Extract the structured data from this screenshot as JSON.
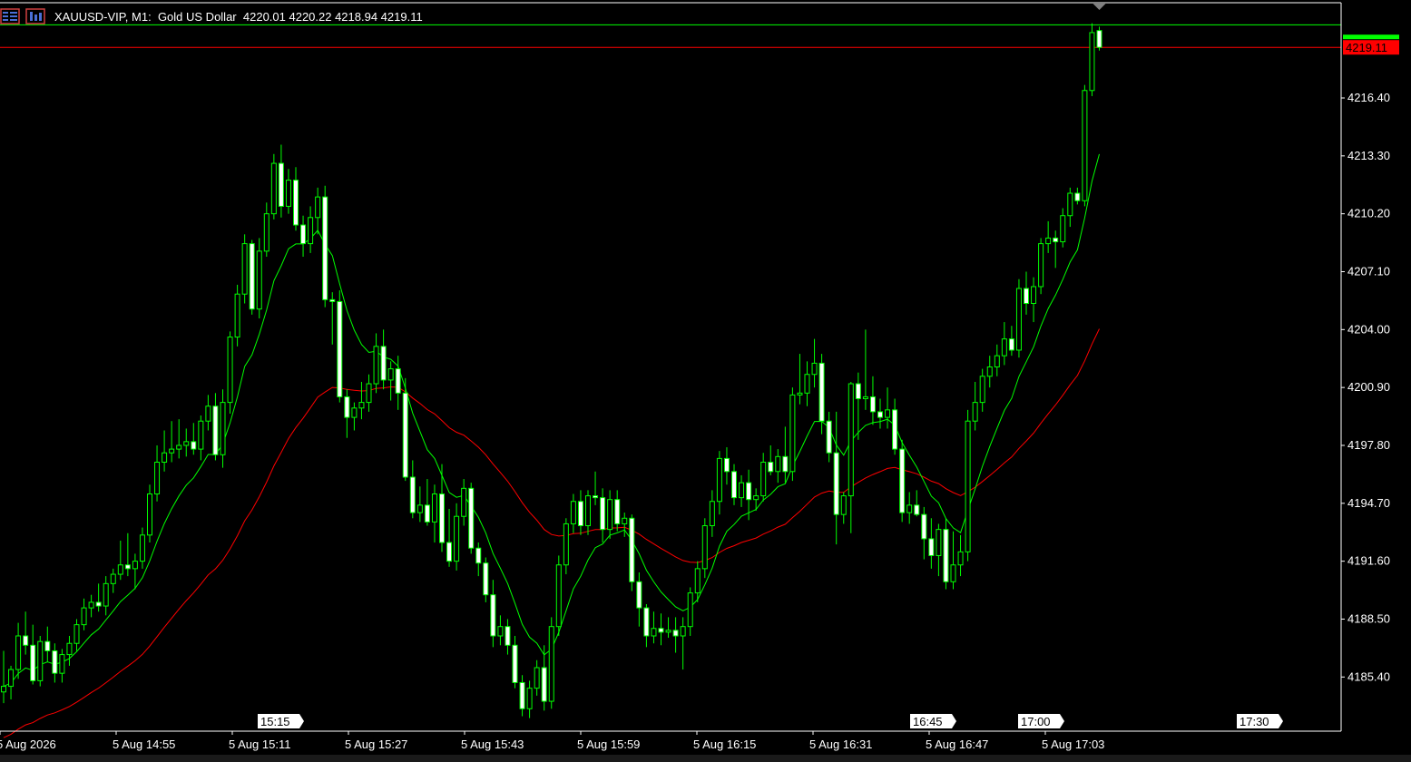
{
  "header": {
    "symbol": "XAUUSD-VIP",
    "timeframe": "M1:",
    "description": "Gold US Dollar",
    "ohlc": "4220.01 4220.22 4218.94 4219.11"
  },
  "chart_data": {
    "type": "candlestick",
    "symbol": "XAUUSD-VIP",
    "timeframe": "M1",
    "current_price": "4219.11",
    "ylim": [
      4182.5,
      4221.5
    ],
    "y_ticks": [
      "4216.40",
      "4213.30",
      "4210.20",
      "4207.10",
      "4204.00",
      "4200.90",
      "4197.80",
      "4194.70",
      "4191.60",
      "4188.50",
      "4185.40"
    ],
    "x_labels": [
      "5 Aug 2026",
      "5 Aug 14:55",
      "5 Aug 15:11",
      "5 Aug 15:27",
      "5 Aug 15:43",
      "5 Aug 15:59",
      "5 Aug 16:15",
      "5 Aug 16:31",
      "5 Aug 16:47",
      "5 Aug 17:03"
    ],
    "time_markers": [
      "15:15",
      "16:45",
      "17:00",
      "17:30"
    ],
    "candles": [
      [
        4184.6,
        4186.8,
        4184.0,
        4184.9
      ],
      [
        4184.9,
        4186.0,
        4184.2,
        4185.8
      ],
      [
        4185.8,
        4188.3,
        4185.3,
        4187.6
      ],
      [
        4187.6,
        4188.9,
        4186.6,
        4187.1
      ],
      [
        4187.1,
        4188.2,
        4185.0,
        4185.2
      ],
      [
        4185.2,
        4187.6,
        4184.9,
        4187.3
      ],
      [
        4187.3,
        4188.1,
        4186.2,
        4186.8
      ],
      [
        4186.8,
        4187.2,
        4185.1,
        4185.6
      ],
      [
        4185.6,
        4186.9,
        4185.1,
        4186.6
      ],
      [
        4186.6,
        4187.6,
        4186.0,
        4187.2
      ],
      [
        4187.2,
        4188.5,
        4186.8,
        4188.2
      ],
      [
        4188.2,
        4189.6,
        4187.9,
        4189.1
      ],
      [
        4189.1,
        4189.8,
        4188.6,
        4189.4
      ],
      [
        4189.4,
        4190.4,
        4188.9,
        4189.2
      ],
      [
        4189.2,
        4190.8,
        4188.7,
        4190.4
      ],
      [
        4190.4,
        4191.2,
        4189.9,
        4190.9
      ],
      [
        4190.9,
        4192.7,
        4190.6,
        4191.4
      ],
      [
        4191.4,
        4193.1,
        4190.8,
        4191.2
      ],
      [
        4191.2,
        4192.0,
        4190.1,
        4191.6
      ],
      [
        4191.6,
        4193.4,
        4191.2,
        4193.0
      ],
      [
        4193.0,
        4195.7,
        4192.6,
        4195.2
      ],
      [
        4195.2,
        4197.8,
        4194.8,
        4196.9
      ],
      [
        4196.9,
        4198.6,
        4196.4,
        4197.4
      ],
      [
        4197.4,
        4199.1,
        4196.9,
        4197.6
      ],
      [
        4197.6,
        4199.2,
        4197.1,
        4197.8
      ],
      [
        4197.8,
        4198.7,
        4197.2,
        4198.0
      ],
      [
        4198.0,
        4199.0,
        4197.3,
        4197.6
      ],
      [
        4197.6,
        4199.4,
        4197.0,
        4199.1
      ],
      [
        4199.1,
        4200.5,
        4198.6,
        4199.9
      ],
      [
        4199.9,
        4200.6,
        4197.0,
        4197.3
      ],
      [
        4197.3,
        4200.8,
        4196.6,
        4200.1
      ],
      [
        4200.1,
        4203.9,
        4199.5,
        4203.6
      ],
      [
        4203.6,
        4206.4,
        4203.1,
        4205.9
      ],
      [
        4205.9,
        4209.1,
        4205.4,
        4208.6
      ],
      [
        4208.6,
        4208.8,
        4204.8,
        4205.1
      ],
      [
        4205.1,
        4208.9,
        4204.6,
        4208.2
      ],
      [
        4208.2,
        4210.8,
        4207.9,
        4210.2
      ],
      [
        4210.2,
        4213.4,
        4209.9,
        4212.9
      ],
      [
        4212.9,
        4213.9,
        4210.0,
        4210.6
      ],
      [
        4210.6,
        4212.6,
        4210.2,
        4212.0
      ],
      [
        4212.0,
        4212.7,
        4209.3,
        4209.6
      ],
      [
        4209.6,
        4210.1,
        4207.9,
        4208.6
      ],
      [
        4208.6,
        4210.6,
        4208.1,
        4210.0
      ],
      [
        4210.0,
        4211.6,
        4209.1,
        4211.1
      ],
      [
        4211.1,
        4211.7,
        4205.2,
        4205.6
      ],
      [
        4205.6,
        4206.0,
        4203.2,
        4205.5
      ],
      [
        4205.5,
        4206.1,
        4200.1,
        4200.4
      ],
      [
        4200.4,
        4200.8,
        4198.2,
        4199.3
      ],
      [
        4199.3,
        4200.1,
        4198.6,
        4199.8
      ],
      [
        4199.8,
        4201.2,
        4199.2,
        4200.1
      ],
      [
        4200.1,
        4201.6,
        4199.6,
        4201.1
      ],
      [
        4201.1,
        4203.8,
        4200.6,
        4203.1
      ],
      [
        4203.1,
        4204.0,
        4200.8,
        4201.3
      ],
      [
        4201.3,
        4202.3,
        4200.2,
        4201.9
      ],
      [
        4201.9,
        4202.6,
        4199.7,
        4200.6
      ],
      [
        4200.6,
        4201.4,
        4195.9,
        4196.1
      ],
      [
        4196.1,
        4197.0,
        4193.9,
        4194.2
      ],
      [
        4194.2,
        4195.6,
        4193.7,
        4194.6
      ],
      [
        4194.6,
        4196.0,
        4193.5,
        4193.7
      ],
      [
        4193.7,
        4195.7,
        4192.6,
        4195.2
      ],
      [
        4195.2,
        4196.8,
        4192.1,
        4192.6
      ],
      [
        4192.6,
        4194.4,
        4191.3,
        4191.6
      ],
      [
        4191.6,
        4194.7,
        4191.1,
        4194.0
      ],
      [
        4194.0,
        4196.0,
        4193.5,
        4195.5
      ],
      [
        4195.5,
        4195.8,
        4192.0,
        4192.3
      ],
      [
        4192.3,
        4192.6,
        4190.8,
        4191.5
      ],
      [
        4191.5,
        4191.8,
        4189.4,
        4189.8
      ],
      [
        4189.8,
        4190.6,
        4187.0,
        4187.6
      ],
      [
        4187.6,
        4188.7,
        4187.1,
        4188.1
      ],
      [
        4188.1,
        4188.5,
        4186.6,
        4187.1
      ],
      [
        4187.1,
        4187.6,
        4184.8,
        4185.1
      ],
      [
        4185.1,
        4185.5,
        4183.3,
        4183.7
      ],
      [
        4183.7,
        4185.2,
        4183.2,
        4184.8
      ],
      [
        4184.8,
        4186.3,
        4184.4,
        4185.9
      ],
      [
        4185.9,
        4187.1,
        4183.6,
        4184.1
      ],
      [
        4184.1,
        4188.6,
        4183.7,
        4188.1
      ],
      [
        4188.1,
        4191.9,
        4187.6,
        4191.4
      ],
      [
        4191.4,
        4193.9,
        4190.9,
        4193.6
      ],
      [
        4193.6,
        4195.2,
        4193.1,
        4194.8
      ],
      [
        4194.8,
        4195.4,
        4193.0,
        4193.5
      ],
      [
        4193.5,
        4195.4,
        4193.0,
        4195.1
      ],
      [
        4195.1,
        4196.4,
        4194.6,
        4195.0
      ],
      [
        4195.0,
        4195.5,
        4192.6,
        4193.3
      ],
      [
        4193.3,
        4195.4,
        4192.8,
        4194.9
      ],
      [
        4194.9,
        4195.4,
        4193.2,
        4193.6
      ],
      [
        4193.6,
        4194.2,
        4192.9,
        4193.9
      ],
      [
        4193.9,
        4194.1,
        4190.0,
        4190.5
      ],
      [
        4190.5,
        4191.0,
        4188.1,
        4189.1
      ],
      [
        4189.1,
        4189.3,
        4187.0,
        4187.6
      ],
      [
        4187.6,
        4188.9,
        4187.2,
        4188.0
      ],
      [
        4188.0,
        4188.8,
        4187.1,
        4187.8
      ],
      [
        4187.8,
        4188.6,
        4187.5,
        4187.9
      ],
      [
        4187.9,
        4188.6,
        4186.7,
        4187.6
      ],
      [
        4187.6,
        4188.6,
        4185.8,
        4188.1
      ],
      [
        4188.1,
        4190.2,
        4187.6,
        4189.9
      ],
      [
        4189.9,
        4191.6,
        4189.4,
        4191.2
      ],
      [
        4191.2,
        4193.9,
        4190.7,
        4193.5
      ],
      [
        4193.5,
        4195.4,
        4192.9,
        4194.8
      ],
      [
        4194.8,
        4197.5,
        4194.1,
        4197.1
      ],
      [
        4197.1,
        4197.7,
        4195.7,
        4196.4
      ],
      [
        4196.4,
        4196.8,
        4194.6,
        4195.0
      ],
      [
        4195.0,
        4196.2,
        4194.5,
        4195.8
      ],
      [
        4195.8,
        4196.5,
        4193.8,
        4194.9
      ],
      [
        4194.9,
        4195.5,
        4194.3,
        4195.1
      ],
      [
        4195.1,
        4197.4,
        4194.8,
        4196.9
      ],
      [
        4196.9,
        4197.8,
        4196.2,
        4196.4
      ],
      [
        4196.4,
        4197.6,
        4195.8,
        4197.2
      ],
      [
        4197.2,
        4198.8,
        4195.8,
        4196.4
      ],
      [
        4196.4,
        4200.9,
        4195.9,
        4200.5
      ],
      [
        4200.5,
        4202.7,
        4200.0,
        4200.6
      ],
      [
        4200.6,
        4202.3,
        4199.9,
        4201.6
      ],
      [
        4201.6,
        4203.5,
        4200.9,
        4202.2
      ],
      [
        4202.2,
        4202.7,
        4198.4,
        4199.1
      ],
      [
        4199.1,
        4199.6,
        4196.9,
        4197.4
      ],
      [
        4197.4,
        4199.6,
        4192.5,
        4194.1
      ],
      [
        4194.1,
        4195.3,
        4193.6,
        4195.1
      ],
      [
        4195.1,
        4201.2,
        4193.1,
        4201.1
      ],
      [
        4201.1,
        4201.7,
        4198.1,
        4200.3
      ],
      [
        4200.3,
        4204.0,
        4199.7,
        4200.4
      ],
      [
        4200.4,
        4201.5,
        4198.9,
        4199.6
      ],
      [
        4199.6,
        4200.3,
        4198.7,
        4199.3
      ],
      [
        4199.3,
        4200.9,
        4198.7,
        4199.7
      ],
      [
        4199.7,
        4200.3,
        4197.3,
        4197.6
      ],
      [
        4197.6,
        4198.1,
        4193.7,
        4194.2
      ],
      [
        4194.2,
        4195.3,
        4193.6,
        4194.6
      ],
      [
        4194.6,
        4195.4,
        4194.0,
        4194.1
      ],
      [
        4194.1,
        4194.5,
        4191.7,
        4192.8
      ],
      [
        4192.8,
        4193.9,
        4191.2,
        4191.9
      ],
      [
        4191.9,
        4193.6,
        4190.8,
        4193.3
      ],
      [
        4193.3,
        4193.9,
        4190.1,
        4190.5
      ],
      [
        4190.5,
        4193.2,
        4190.1,
        4191.4
      ],
      [
        4191.4,
        4193.0,
        4190.8,
        4192.1
      ],
      [
        4192.1,
        4199.7,
        4191.6,
        4199.1
      ],
      [
        4199.1,
        4201.2,
        4198.6,
        4200.1
      ],
      [
        4200.1,
        4201.9,
        4199.6,
        4201.5
      ],
      [
        4201.5,
        4202.6,
        4200.9,
        4202.0
      ],
      [
        4202.0,
        4203.2,
        4201.5,
        4202.6
      ],
      [
        4202.6,
        4204.4,
        4202.1,
        4203.5
      ],
      [
        4203.5,
        4204.2,
        4202.6,
        4202.9
      ],
      [
        4202.9,
        4206.7,
        4202.5,
        4206.2
      ],
      [
        4206.2,
        4207.1,
        4204.8,
        4205.4
      ],
      [
        4205.4,
        4206.8,
        4204.4,
        4206.3
      ],
      [
        4206.3,
        4208.9,
        4205.9,
        4208.6
      ],
      [
        4208.6,
        4209.8,
        4208.1,
        4208.9
      ],
      [
        4208.9,
        4209.3,
        4207.3,
        4208.7
      ],
      [
        4208.7,
        4210.5,
        4208.4,
        4210.1
      ],
      [
        4210.1,
        4211.6,
        4209.5,
        4211.3
      ],
      [
        4211.3,
        4211.6,
        4210.7,
        4210.9
      ],
      [
        4210.9,
        4217.1,
        4210.6,
        4216.8
      ],
      [
        4216.8,
        4220.4,
        4216.5,
        4219.9
      ],
      [
        4220.01,
        4220.22,
        4218.94,
        4219.11
      ]
    ]
  },
  "colors": {
    "background": "#000000",
    "candle_up_body": "#000000",
    "candle_down_body": "#ffffff",
    "candle_outline": "#00ff00",
    "ma_fast": "#00ff00",
    "ma_slow": "#ff0000",
    "current_price_label": "#ff0000",
    "axis_text": "#ffffff"
  },
  "icons": [
    "chart-menu-icon",
    "chart-properties-icon"
  ]
}
